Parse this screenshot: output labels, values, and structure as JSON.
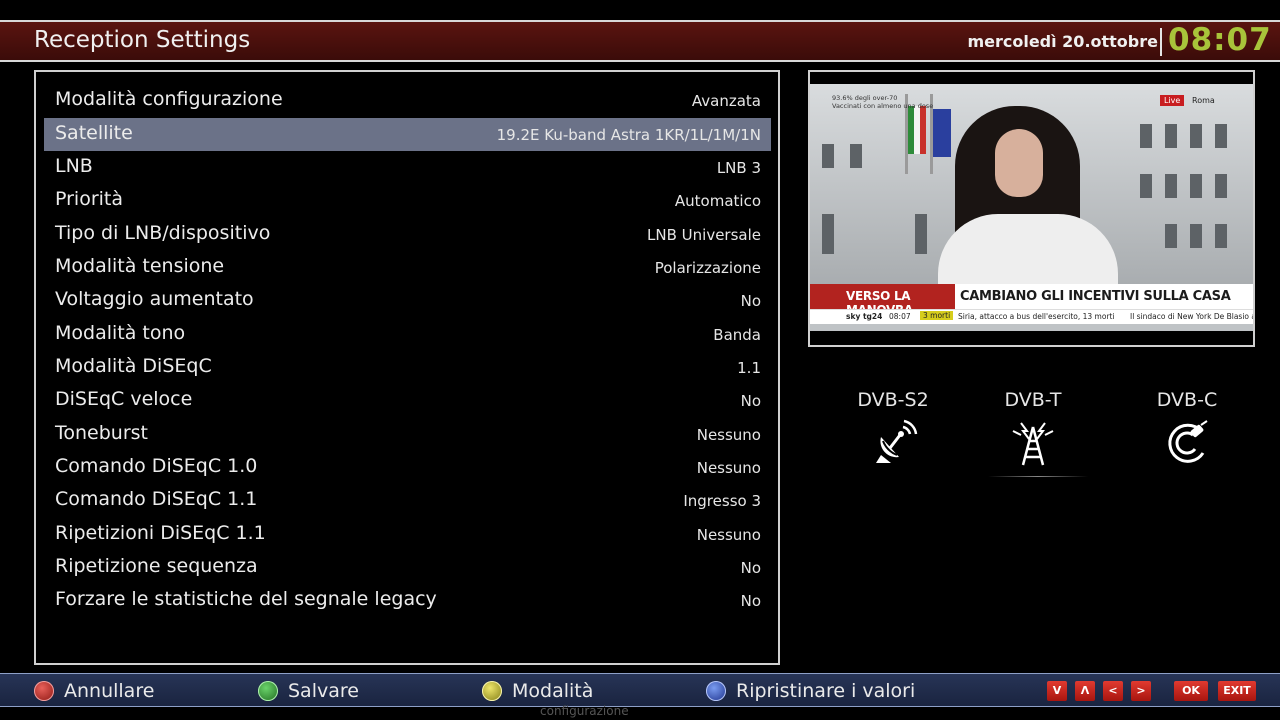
{
  "header": {
    "title": "Reception Settings",
    "date": "mercoledì 20.ottobre",
    "time": "08:07"
  },
  "settings": [
    {
      "label": "Modalità configurazione",
      "value": "Avanzata"
    },
    {
      "label": "Satellite",
      "value": "19.2E Ku-band Astra 1KR/1L/1M/1N",
      "selected": true
    },
    {
      "label": "LNB",
      "value": "LNB 3"
    },
    {
      "label": "Priorità",
      "value": "Automatico"
    },
    {
      "label": "Tipo di LNB/dispositivo",
      "value": "LNB Universale"
    },
    {
      "label": "Modalità tensione",
      "value": "Polarizzazione"
    },
    {
      "label": "Voltaggio aumentato",
      "value": "No"
    },
    {
      "label": "Modalità tono",
      "value": "Banda"
    },
    {
      "label": "Modalità DiSEqC",
      "value": "1.1"
    },
    {
      "label": "DiSEqC veloce",
      "value": "No"
    },
    {
      "label": "Toneburst",
      "value": "Nessuno"
    },
    {
      "label": "Comando DiSEqC 1.0",
      "value": "Nessuno"
    },
    {
      "label": "Comando DiSEqC 1.1",
      "value": "Ingresso 3"
    },
    {
      "label": "Ripetizioni DiSEqC 1.1",
      "value": "Nessuno"
    },
    {
      "label": "Ripetizione sequenza",
      "value": "No"
    },
    {
      "label": "Forzare le statistiche del segnale legacy",
      "value": "No"
    }
  ],
  "preview": {
    "overlay_top_line1": "93.6% degli over-70",
    "overlay_top_line2": "Vaccinati con almeno una dose",
    "live": "Live",
    "city": "Roma",
    "banner_left": "VERSO LA MANOVRA",
    "banner_right": "CAMBIANO GLI INCENTIVI SULLA CASA",
    "ticker_logo": "sky tg24",
    "ticker_time": "08:07",
    "ticker_badge": "3 morti",
    "ticker_news1": "Siria, attacco a bus dell'esercito, 13 morti",
    "ticker_news2": "Il sindaco di New York De Blasio a"
  },
  "tuners": [
    {
      "label": "DVB-S2",
      "icon": "satellite-dish-icon"
    },
    {
      "label": "DVB-T",
      "icon": "antenna-tower-icon"
    },
    {
      "label": "DVB-C",
      "icon": "cable-icon"
    }
  ],
  "footer": {
    "buttons": [
      {
        "label": "Annullare",
        "color": "#c8302a"
      },
      {
        "label": "Salvare",
        "color": "#3aa23a"
      },
      {
        "label": "Modalità",
        "color": "#c9c02a"
      },
      {
        "label": "Ripristinare i valori",
        "color": "#3a5fd0"
      }
    ],
    "keys": [
      "V",
      "Λ",
      "<",
      ">",
      "OK",
      "EXIT"
    ],
    "ghost_text": "configurazione"
  }
}
